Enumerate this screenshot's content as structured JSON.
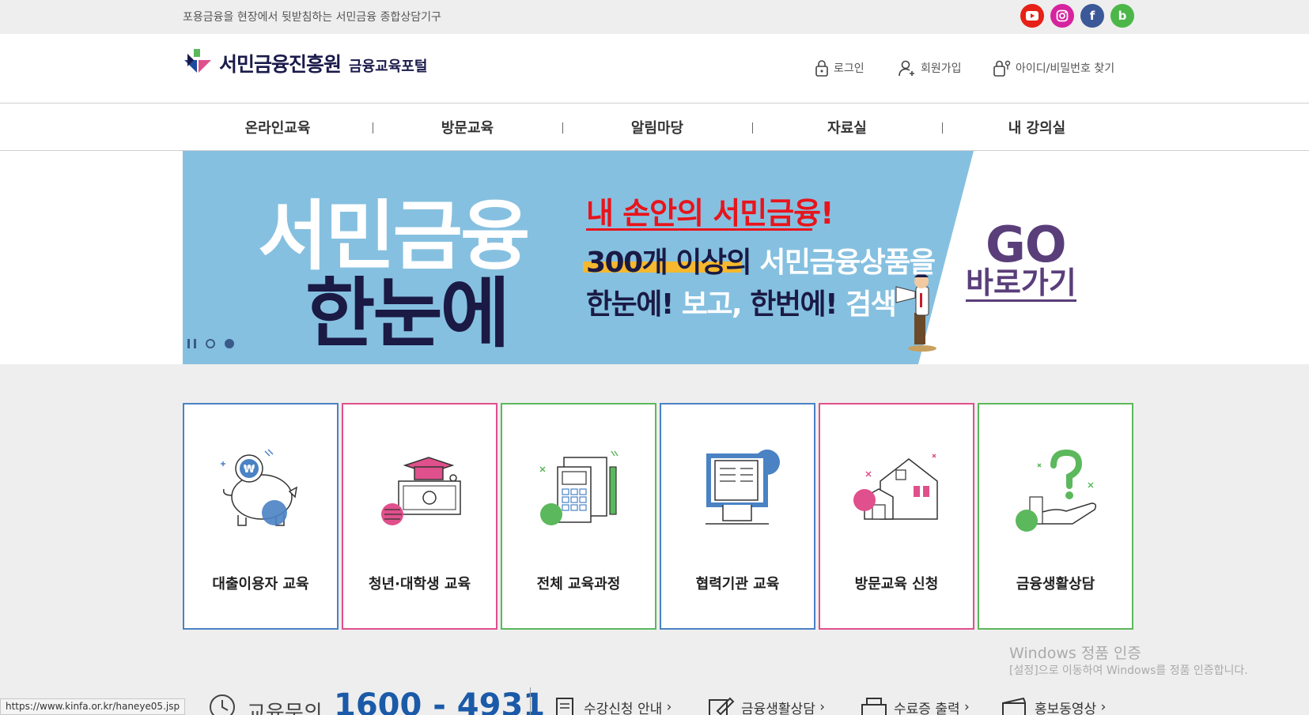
{
  "topbar": {
    "slogan": "포용금융을 현장에서 뒷받침하는 서민금융 종합상담기구"
  },
  "social": [
    {
      "name": "youtube",
      "label": "",
      "color": "#e62117"
    },
    {
      "name": "instagram",
      "label": "",
      "color": "#d6249f"
    },
    {
      "name": "facebook",
      "label": "f",
      "color": "#3b5998"
    },
    {
      "name": "blog",
      "label": "b",
      "color": "#4cb748"
    }
  ],
  "logo": {
    "name": "서민금융진흥원",
    "sub": "금융교육포털"
  },
  "util": {
    "login": "로그인",
    "join": "회원가입",
    "find": "아이디/비밀번호 찾기"
  },
  "gnb": [
    "온라인교육",
    "방문교육",
    "알림마당",
    "자료실",
    "내 강의실"
  ],
  "banner": {
    "title1": "서민금융",
    "title2": "한눈에",
    "red": "내 손안의 서민금융!",
    "line2_a": "300개 이상의 ",
    "line2_b": "서민금융상품을",
    "line3_a": "한눈에! ",
    "line3_b": "보고, ",
    "line3_c": "한번에! ",
    "line3_d": "검색",
    "go": "GO",
    "go2": "바로가기"
  },
  "cards": [
    {
      "label": "대출이용자 교육",
      "border": "#4a82c4",
      "icon": "piggy-bank-icon"
    },
    {
      "label": "청년·대학생 교육",
      "border": "#e0508c",
      "icon": "graduation-money-icon"
    },
    {
      "label": "전체 교육과정",
      "border": "#5cb85c",
      "icon": "calculator-icon"
    },
    {
      "label": "협력기관 교육",
      "border": "#4a82c4",
      "icon": "document-hand-icon"
    },
    {
      "label": "방문교육 신청",
      "border": "#e0508c",
      "icon": "house-icon"
    },
    {
      "label": "금융생활상담",
      "border": "#5cb85c",
      "icon": "question-hand-icon"
    }
  ],
  "watermark": {
    "line1": "Windows 정품 인증",
    "line2": "[설정]으로 이동하여 Windows를 정품 인증합니다."
  },
  "footer": {
    "label": "교육문의",
    "phone": "1600 - 4931",
    "quick": [
      "수강신청 안내",
      "금융생활상담",
      "수료증 출력",
      "홍보동영상"
    ]
  },
  "statusbar": "https://www.kinfa.or.kr/haneye05.jsp"
}
